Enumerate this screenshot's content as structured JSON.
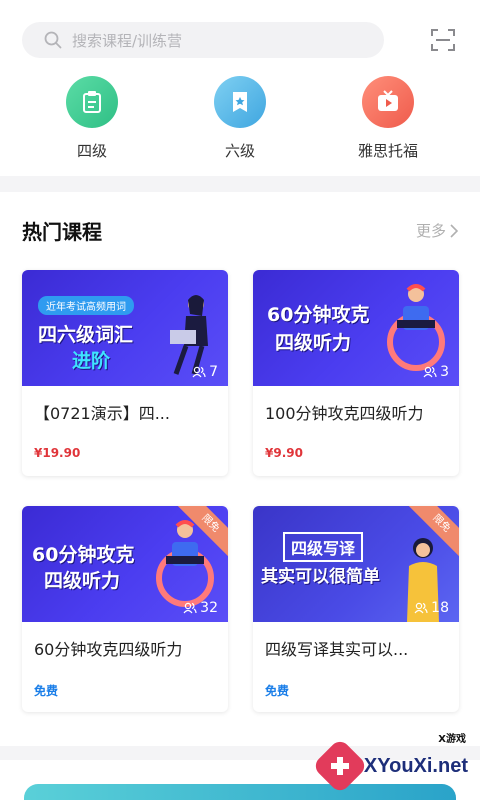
{
  "search": {
    "placeholder": "搜索课程/训练营"
  },
  "categories": [
    {
      "label": "四级",
      "color": "#38c98e",
      "icon": "notebook-icon"
    },
    {
      "label": "六级",
      "color": "#56b7e6",
      "icon": "book-star-icon"
    },
    {
      "label": "雅思托福",
      "color": "#f26b5b",
      "icon": "play-tv-icon"
    }
  ],
  "section": {
    "title": "热门课程",
    "more": "更多"
  },
  "courses": [
    {
      "thumb_tag": "近年考试高频用词",
      "thumb_line1": "四六级词汇",
      "thumb_line2": "进阶",
      "enrolled": "7",
      "title": "【0721演示】四...",
      "price": "¥19.90",
      "free": false,
      "ribbon": ""
    },
    {
      "thumb_tag": "",
      "thumb_line1": "60分钟攻克",
      "thumb_line2": "四级听力",
      "enrolled": "3",
      "title": "100分钟攻克四级听力",
      "price": "¥9.90",
      "free": false,
      "ribbon": ""
    },
    {
      "thumb_tag": "",
      "thumb_line1": "60分钟攻克",
      "thumb_line2": "四级听力",
      "enrolled": "32",
      "title": "60分钟攻克四级听力",
      "price": "免费",
      "free": true,
      "ribbon": "限免"
    },
    {
      "thumb_tag": "",
      "thumb_line1": "四级写译",
      "thumb_line2": "其实可以很简单",
      "enrolled": "18",
      "title": "四级写译其实可以...",
      "price": "免费",
      "free": true,
      "ribbon": "限免"
    }
  ],
  "watermark": {
    "text": "XYouXi.net",
    "sub": "X游戏"
  }
}
